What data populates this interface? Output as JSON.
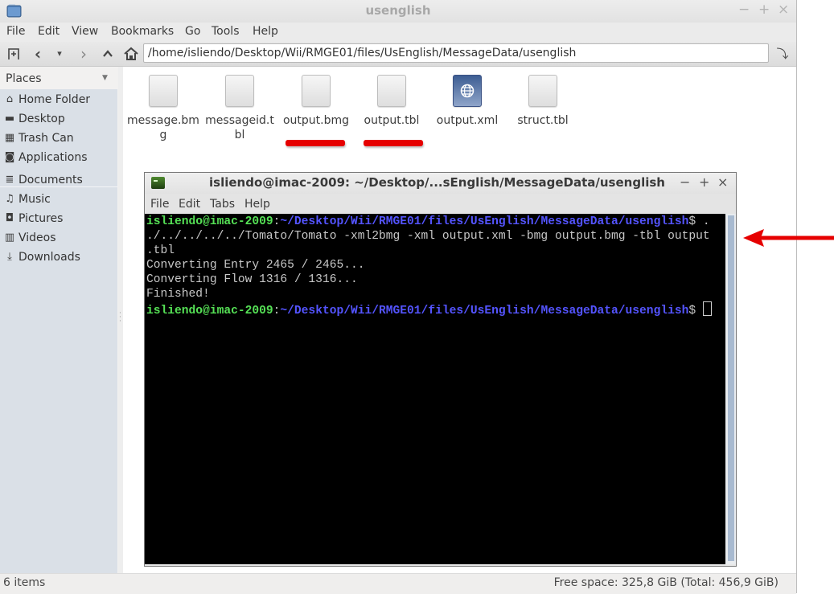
{
  "window": {
    "title": "usenglish",
    "controls": {
      "minimize": "−",
      "maximize": "+",
      "close": "×"
    }
  },
  "menubar": [
    "File",
    "Edit",
    "View",
    "Bookmarks",
    "Go",
    "Tools",
    "Help"
  ],
  "toolbar": {
    "new_tab_icon": "new-tab",
    "back_icon": "‹",
    "history_icon": "▾",
    "forward_icon": "›",
    "up_icon": "^",
    "home_icon": "⌂",
    "path": "/home/isliendo/Desktop/Wii/RMGE01/files/UsEnglish/MessageData/usenglish",
    "go_icon": "⤵"
  },
  "sidebar": {
    "header": "Places",
    "items": [
      {
        "label": "Home Folder",
        "icon": "⌂"
      },
      {
        "label": "Desktop",
        "icon": "▬"
      },
      {
        "label": "Trash Can",
        "icon": "▦"
      },
      {
        "label": "Applications",
        "icon": "◙"
      },
      {
        "label": "Documents",
        "icon": "≣"
      },
      {
        "label": "Music",
        "icon": "♫"
      },
      {
        "label": "Pictures",
        "icon": "◘"
      },
      {
        "label": "Videos",
        "icon": "▥"
      },
      {
        "label": "Downloads",
        "icon": "⤓"
      }
    ]
  },
  "files": [
    {
      "name": "message.bmg",
      "type": "generic"
    },
    {
      "name": "messageid.tbl",
      "type": "generic"
    },
    {
      "name": "output.bmg",
      "type": "generic",
      "highlighted": true
    },
    {
      "name": "output.tbl",
      "type": "generic",
      "highlighted": true
    },
    {
      "name": "output.xml",
      "type": "xml"
    },
    {
      "name": "struct.tbl",
      "type": "generic"
    }
  ],
  "statusbar": {
    "items": "6 items",
    "free_space": "Free space: 325,8 GiB (Total: 456,9 GiB)"
  },
  "terminal": {
    "title": "isliendo@imac-2009: ~/Desktop/...sEnglish/MessageData/usenglish",
    "controls": {
      "minimize": "−",
      "maximize": "+",
      "close": "×"
    },
    "menubar": [
      "File",
      "Edit",
      "Tabs",
      "Help"
    ],
    "prompt_user": "isliendo@imac-2009",
    "prompt_sep": ":",
    "prompt_path": "~/Desktop/Wii/RMGE01/files/UsEnglish/MessageData/usenglish",
    "prompt_end": "$ ",
    "command_first": ".",
    "command_line2": "./../../../../Tomato/Tomato -xml2bmg -xml output.xml -bmg output.bmg -tbl output",
    "command_line3": ".tbl",
    "output": [
      "Converting Entry 2465 / 2465...",
      "Converting Flow 1316 / 1316...",
      "Finished!"
    ]
  },
  "colors": {
    "prompt_user": "#55e055",
    "prompt_path": "#5454ff",
    "annotation_red": "#e60000"
  }
}
